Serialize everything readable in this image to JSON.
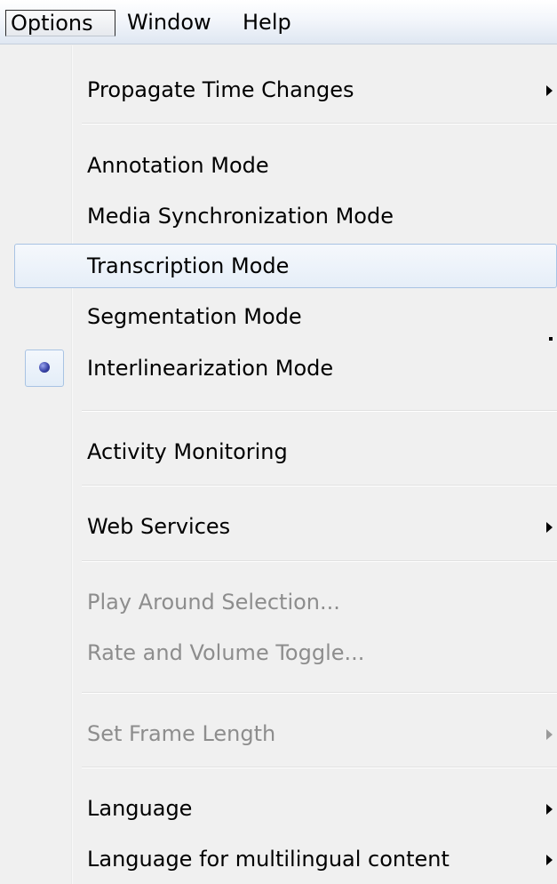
{
  "menubar": {
    "items": [
      {
        "label": "Options"
      },
      {
        "label": "Window"
      },
      {
        "label": "Help"
      }
    ]
  },
  "menu": {
    "items": [
      {
        "label": "Propagate Time Changes",
        "submenu": true,
        "enabled": true
      },
      {
        "label": "Annotation Mode",
        "enabled": true
      },
      {
        "label": "Media Synchronization Mode",
        "enabled": true
      },
      {
        "label": "Transcription Mode",
        "enabled": true,
        "highlighted": true
      },
      {
        "label": "Segmentation Mode",
        "enabled": true
      },
      {
        "label": "Interlinearization Mode",
        "enabled": true,
        "selected": true
      },
      {
        "label": "Activity Monitoring",
        "enabled": true
      },
      {
        "label": "Web Services",
        "submenu": true,
        "enabled": true
      },
      {
        "label": "Play Around Selection...",
        "enabled": false
      },
      {
        "label": "Rate and Volume Toggle...",
        "enabled": false
      },
      {
        "label": "Set Frame Length",
        "submenu": true,
        "enabled": false
      },
      {
        "label": "Language",
        "submenu": true,
        "enabled": true
      },
      {
        "label": "Language for multilingual content",
        "submenu": true,
        "enabled": true
      }
    ]
  },
  "icons": {
    "radio": "radio-selected-icon",
    "submenu": "submenu-arrow-icon"
  },
  "colors": {
    "menu_background": "#f0f0f0",
    "highlight_border": "#a8c3e3",
    "disabled_text": "#8d8d8d",
    "radio_dot": "#3a44a8"
  }
}
